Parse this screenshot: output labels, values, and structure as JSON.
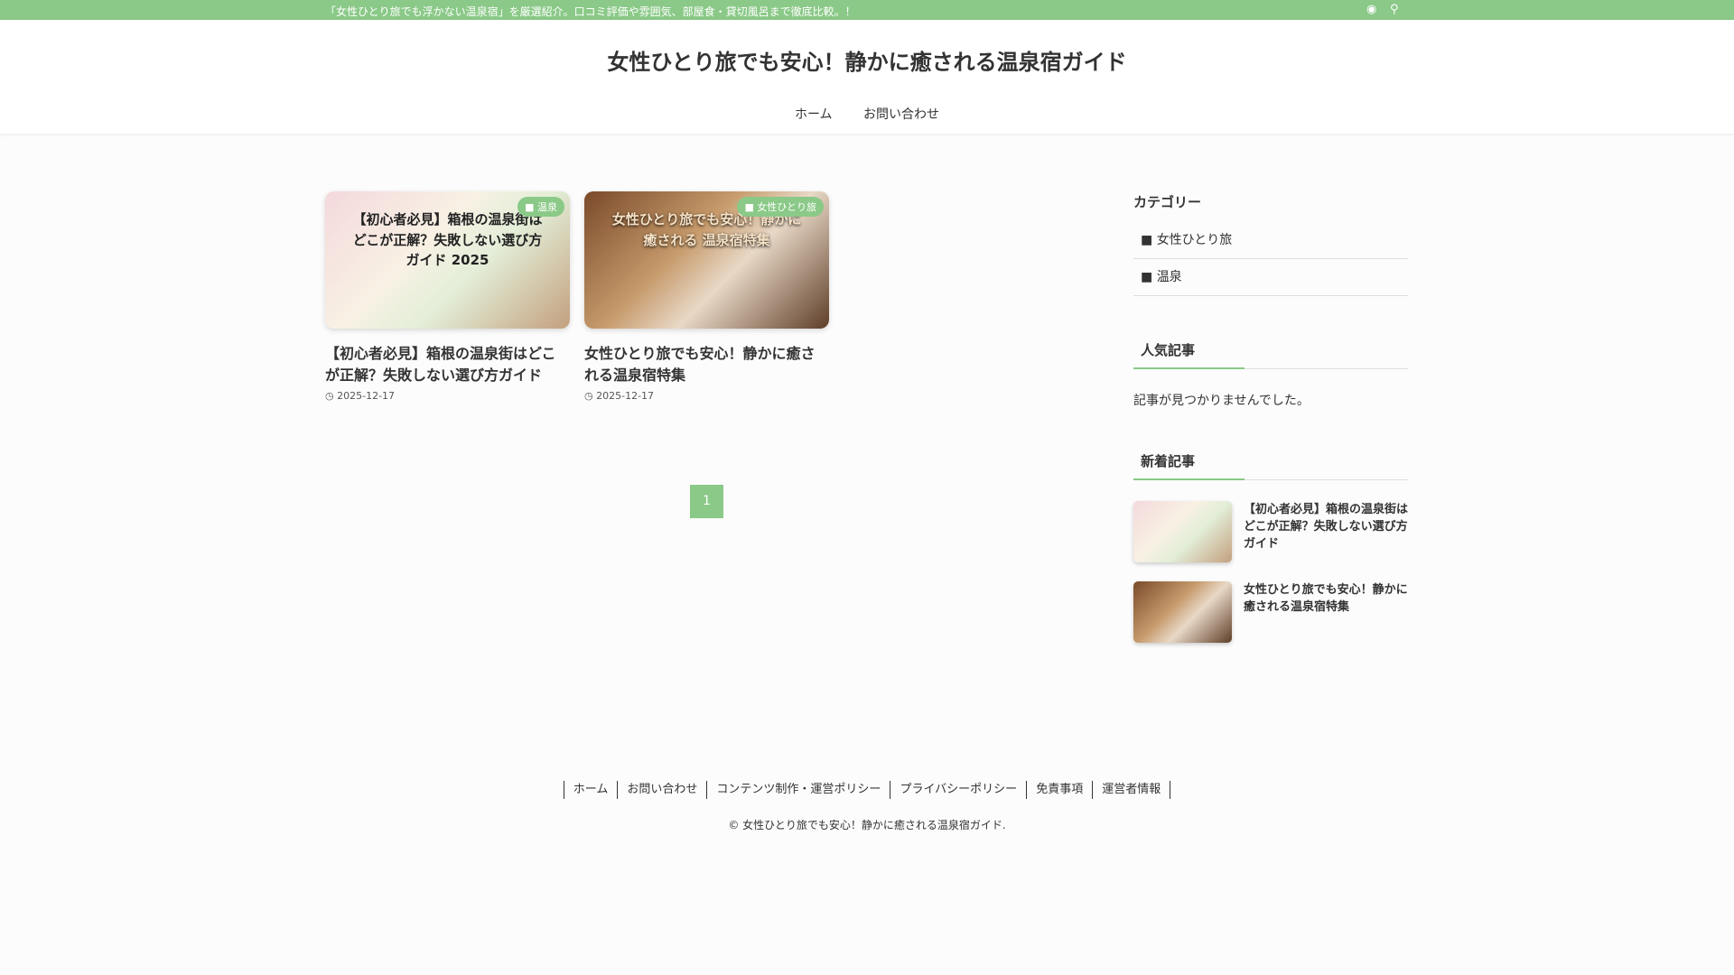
{
  "topbar": {
    "message": "「女性ひとり旅でも浮かない温泉宿」を厳選紹介。口コミ評価や雰囲気、部屋食・貸切風呂まで徹底比較。！",
    "rss_icon": "rss-icon",
    "search_icon": "search-icon"
  },
  "header": {
    "site_title": "女性ひとり旅でも安心！静かに癒される温泉宿ガイド",
    "nav": [
      "ホーム",
      "お問い合わせ"
    ]
  },
  "posts": [
    {
      "thumb_caption": "【初心者必見】箱根の温泉街はどこが正解？失敗しない選び方ガイド 2025",
      "category": "温泉",
      "title": "【初心者必見】箱根の温泉街はどこが正解？失敗しない選び方ガイド",
      "date": "2025-12-17"
    },
    {
      "thumb_caption": "女性ひとり旅でも安心！静かに癒される 温泉宿特集",
      "category": "女性ひとり旅",
      "title": "女性ひとり旅でも安心！静かに癒される温泉宿特集",
      "date": "2025-12-17"
    }
  ],
  "pagination": {
    "current": "1"
  },
  "sidebar": {
    "categories_title": "カテゴリー",
    "categories": [
      "女性ひとり旅",
      "温泉"
    ],
    "popular_title": "人気記事",
    "popular_empty": "記事が見つかりませんでした。",
    "new_title": "新着記事",
    "new_posts": [
      {
        "title": "【初心者必見】箱根の温泉街はどこが正解？失敗しない選び方ガイド"
      },
      {
        "title": "女性ひとり旅でも安心！静かに癒される温泉宿特集"
      }
    ]
  },
  "footer": {
    "links": [
      "ホーム",
      "お問い合わせ",
      "コンテンツ制作・運営ポリシー",
      "プライバシーポリシー",
      "免責事項",
      "運営者情報"
    ],
    "copyright": "© 女性ひとり旅でも安心！静かに癒される温泉宿ガイド."
  },
  "colors": {
    "accent": "#8ac987"
  }
}
